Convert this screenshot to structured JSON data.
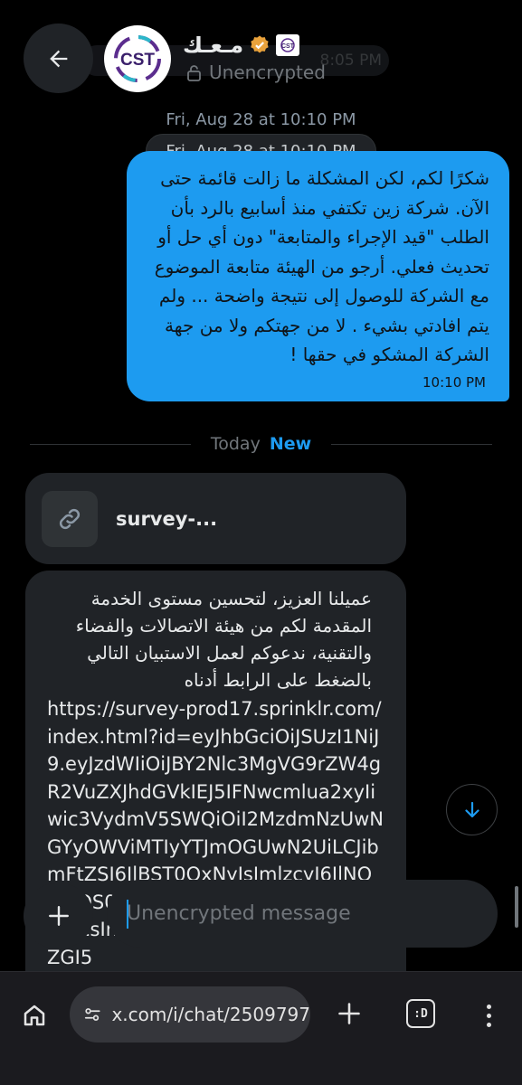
{
  "header": {
    "contact_name": "مـعـك",
    "encryption_status": "Unencrypted",
    "ghost_time": "8:05 PM",
    "avatar_logo_text": "CST",
    "mini_logo_text": "CST"
  },
  "dates": {
    "top": "Fri, Aug 28 at 10:10 PM",
    "pill": "Fri, Aug 28 at 10:10 PM"
  },
  "outgoing_message": {
    "text": "شكرًا لكم، لكن المشكلة ما زالت قائمة حتى الآن. شركة زين تكتفي منذ أسابيع بالرد بأن الطلب \"قيد الإجراء والمتابعة\" دون أي حل أو تحديث فعلي. أرجو من الهيئة متابعة الموضوع مع الشركة للوصول إلى نتيجة واضحة ... ولم يتم افادتي بشيء . لا من جهتكم ولا من جهة الشركة المشكو في حقها !",
    "time": "10:10 PM"
  },
  "divider": {
    "today": "Today",
    "new": "New"
  },
  "link_card": {
    "title": "survey-..."
  },
  "incoming_message": {
    "arabic_text": "عميلنا العزيز، لتحسين مستوى الخدمة المقدمة لكم من هيئة الاتصالات والفضاء والتقنية، ندعوكم لعمل الاستبيان التالي بالضغط على الرابط أدناه",
    "url_text": "https://survey-prod17.sprinklr.com/index.html?id=eyJhbGciOiJSUzI1NiJ9.eyJzdWIiOiJBY2Nlc3MgVG9rZW4gR2VuZXJhdGVkIEJ5IFNwcmlua2xyIiwic3VydmV5SWQiOiI2MzdmNzUwNGYyOWViMTIyYTJmOGUwN2UiLCJibmFtZSI6IlBST0QxNyIsImlzcyI6IlNQUklOS0xSIiwiY2xpZW50SWQiOjEwMDEsImxhbmciOiJlbiIsIm9VdWlkIjoiZGI5"
  },
  "composer": {
    "placeholder": "Unencrypted message"
  },
  "browser": {
    "url": "x.com/i/chat/2509797"
  },
  "colors": {
    "accent": "#1d9bf0",
    "bubble_incoming": "#202327",
    "background": "#000000",
    "verified_badge": "#e9a23b"
  },
  "icons": {
    "back": "back-arrow-icon",
    "lock": "lock-icon",
    "verified": "verified-badge-icon",
    "link": "link-icon",
    "scroll_down": "arrow-down-icon",
    "plus": "plus-icon",
    "home": "home-icon",
    "site_settings": "tune-icon",
    "new_tab": "plus-icon",
    "tabs": "tab-switcher-icon",
    "menu": "more-vertical-icon"
  }
}
